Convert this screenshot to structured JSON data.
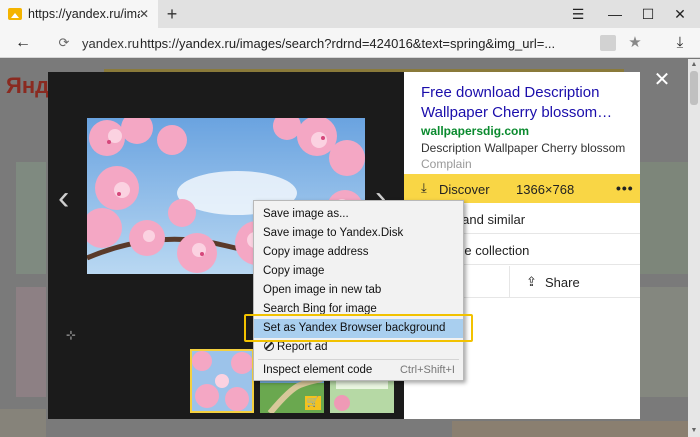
{
  "browser": {
    "tab": {
      "title": "https://yandex.ru/images",
      "close": "✕"
    },
    "new_tab": "+",
    "window_controls": {
      "menu": "☰",
      "minimize": "—",
      "maximize": "☐",
      "close": "✕"
    },
    "address": {
      "back": "←",
      "reload": "⟳",
      "domain": "yandex.ru",
      "url": "https://yandex.ru/images/search?rdrnd=424016&text=spring&img_url=...",
      "star": "★",
      "download": "⤓"
    }
  },
  "background_page": {
    "logo": "Янд"
  },
  "viewer": {
    "close": "✕",
    "prev_arrow": "‹",
    "next_arrow": "›",
    "small_icon": "⊹",
    "result": {
      "title": "Free download Description Wallpaper Cherry blossom…",
      "site": "wallpapersdig.com",
      "description": "Description Wallpaper Cherry blossom",
      "complain": "Complain"
    },
    "discover": {
      "icon": "⤓",
      "label": "Discover",
      "size": "1366×768",
      "menu": "•••"
    },
    "actions": [
      {
        "label": "r sizes and similar"
      },
      {
        "label": "dd to the collection"
      }
    ],
    "share": {
      "icon": "⇪",
      "label": "Share"
    }
  },
  "context_menu": {
    "items": [
      {
        "label": "Save image as..."
      },
      {
        "label": "Save image to Yandex.Disk"
      },
      {
        "label": "Copy image address"
      },
      {
        "label": "Copy image"
      },
      {
        "label": "Open image in new tab"
      },
      {
        "label": "Search Bing for image"
      },
      {
        "label": "Set as Yandex Browser background",
        "highlighted": true
      },
      {
        "label": "Report ad"
      },
      {
        "label": "Inspect element code",
        "shortcut": "Ctrl+Shift+I"
      }
    ]
  },
  "colors": {
    "accent_yellow": "#f9d645",
    "link_blue": "#1a0dab",
    "site_green": "#0a8a2e",
    "menu_highlight": "#a9cfef",
    "callout_yellow": "#f2c200"
  }
}
